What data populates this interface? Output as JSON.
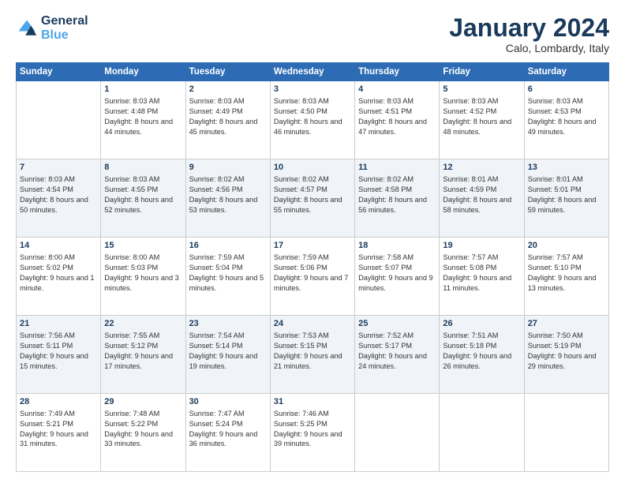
{
  "logo": {
    "line1": "General",
    "line2": "Blue"
  },
  "header": {
    "title": "January 2024",
    "location": "Calo, Lombardy, Italy"
  },
  "weekdays": [
    "Sunday",
    "Monday",
    "Tuesday",
    "Wednesday",
    "Thursday",
    "Friday",
    "Saturday"
  ],
  "weeks": [
    [
      {
        "day": "",
        "sunrise": "",
        "sunset": "",
        "daylight": ""
      },
      {
        "day": "1",
        "sunrise": "Sunrise: 8:03 AM",
        "sunset": "Sunset: 4:48 PM",
        "daylight": "Daylight: 8 hours and 44 minutes."
      },
      {
        "day": "2",
        "sunrise": "Sunrise: 8:03 AM",
        "sunset": "Sunset: 4:49 PM",
        "daylight": "Daylight: 8 hours and 45 minutes."
      },
      {
        "day": "3",
        "sunrise": "Sunrise: 8:03 AM",
        "sunset": "Sunset: 4:50 PM",
        "daylight": "Daylight: 8 hours and 46 minutes."
      },
      {
        "day": "4",
        "sunrise": "Sunrise: 8:03 AM",
        "sunset": "Sunset: 4:51 PM",
        "daylight": "Daylight: 8 hours and 47 minutes."
      },
      {
        "day": "5",
        "sunrise": "Sunrise: 8:03 AM",
        "sunset": "Sunset: 4:52 PM",
        "daylight": "Daylight: 8 hours and 48 minutes."
      },
      {
        "day": "6",
        "sunrise": "Sunrise: 8:03 AM",
        "sunset": "Sunset: 4:53 PM",
        "daylight": "Daylight: 8 hours and 49 minutes."
      }
    ],
    [
      {
        "day": "7",
        "sunrise": "Sunrise: 8:03 AM",
        "sunset": "Sunset: 4:54 PM",
        "daylight": "Daylight: 8 hours and 50 minutes."
      },
      {
        "day": "8",
        "sunrise": "Sunrise: 8:03 AM",
        "sunset": "Sunset: 4:55 PM",
        "daylight": "Daylight: 8 hours and 52 minutes."
      },
      {
        "day": "9",
        "sunrise": "Sunrise: 8:02 AM",
        "sunset": "Sunset: 4:56 PM",
        "daylight": "Daylight: 8 hours and 53 minutes."
      },
      {
        "day": "10",
        "sunrise": "Sunrise: 8:02 AM",
        "sunset": "Sunset: 4:57 PM",
        "daylight": "Daylight: 8 hours and 55 minutes."
      },
      {
        "day": "11",
        "sunrise": "Sunrise: 8:02 AM",
        "sunset": "Sunset: 4:58 PM",
        "daylight": "Daylight: 8 hours and 56 minutes."
      },
      {
        "day": "12",
        "sunrise": "Sunrise: 8:01 AM",
        "sunset": "Sunset: 4:59 PM",
        "daylight": "Daylight: 8 hours and 58 minutes."
      },
      {
        "day": "13",
        "sunrise": "Sunrise: 8:01 AM",
        "sunset": "Sunset: 5:01 PM",
        "daylight": "Daylight: 8 hours and 59 minutes."
      }
    ],
    [
      {
        "day": "14",
        "sunrise": "Sunrise: 8:00 AM",
        "sunset": "Sunset: 5:02 PM",
        "daylight": "Daylight: 9 hours and 1 minute."
      },
      {
        "day": "15",
        "sunrise": "Sunrise: 8:00 AM",
        "sunset": "Sunset: 5:03 PM",
        "daylight": "Daylight: 9 hours and 3 minutes."
      },
      {
        "day": "16",
        "sunrise": "Sunrise: 7:59 AM",
        "sunset": "Sunset: 5:04 PM",
        "daylight": "Daylight: 9 hours and 5 minutes."
      },
      {
        "day": "17",
        "sunrise": "Sunrise: 7:59 AM",
        "sunset": "Sunset: 5:06 PM",
        "daylight": "Daylight: 9 hours and 7 minutes."
      },
      {
        "day": "18",
        "sunrise": "Sunrise: 7:58 AM",
        "sunset": "Sunset: 5:07 PM",
        "daylight": "Daylight: 9 hours and 9 minutes."
      },
      {
        "day": "19",
        "sunrise": "Sunrise: 7:57 AM",
        "sunset": "Sunset: 5:08 PM",
        "daylight": "Daylight: 9 hours and 11 minutes."
      },
      {
        "day": "20",
        "sunrise": "Sunrise: 7:57 AM",
        "sunset": "Sunset: 5:10 PM",
        "daylight": "Daylight: 9 hours and 13 minutes."
      }
    ],
    [
      {
        "day": "21",
        "sunrise": "Sunrise: 7:56 AM",
        "sunset": "Sunset: 5:11 PM",
        "daylight": "Daylight: 9 hours and 15 minutes."
      },
      {
        "day": "22",
        "sunrise": "Sunrise: 7:55 AM",
        "sunset": "Sunset: 5:12 PM",
        "daylight": "Daylight: 9 hours and 17 minutes."
      },
      {
        "day": "23",
        "sunrise": "Sunrise: 7:54 AM",
        "sunset": "Sunset: 5:14 PM",
        "daylight": "Daylight: 9 hours and 19 minutes."
      },
      {
        "day": "24",
        "sunrise": "Sunrise: 7:53 AM",
        "sunset": "Sunset: 5:15 PM",
        "daylight": "Daylight: 9 hours and 21 minutes."
      },
      {
        "day": "25",
        "sunrise": "Sunrise: 7:52 AM",
        "sunset": "Sunset: 5:17 PM",
        "daylight": "Daylight: 9 hours and 24 minutes."
      },
      {
        "day": "26",
        "sunrise": "Sunrise: 7:51 AM",
        "sunset": "Sunset: 5:18 PM",
        "daylight": "Daylight: 9 hours and 26 minutes."
      },
      {
        "day": "27",
        "sunrise": "Sunrise: 7:50 AM",
        "sunset": "Sunset: 5:19 PM",
        "daylight": "Daylight: 9 hours and 29 minutes."
      }
    ],
    [
      {
        "day": "28",
        "sunrise": "Sunrise: 7:49 AM",
        "sunset": "Sunset: 5:21 PM",
        "daylight": "Daylight: 9 hours and 31 minutes."
      },
      {
        "day": "29",
        "sunrise": "Sunrise: 7:48 AM",
        "sunset": "Sunset: 5:22 PM",
        "daylight": "Daylight: 9 hours and 33 minutes."
      },
      {
        "day": "30",
        "sunrise": "Sunrise: 7:47 AM",
        "sunset": "Sunset: 5:24 PM",
        "daylight": "Daylight: 9 hours and 36 minutes."
      },
      {
        "day": "31",
        "sunrise": "Sunrise: 7:46 AM",
        "sunset": "Sunset: 5:25 PM",
        "daylight": "Daylight: 9 hours and 39 minutes."
      },
      {
        "day": "",
        "sunrise": "",
        "sunset": "",
        "daylight": ""
      },
      {
        "day": "",
        "sunrise": "",
        "sunset": "",
        "daylight": ""
      },
      {
        "day": "",
        "sunrise": "",
        "sunset": "",
        "daylight": ""
      }
    ]
  ]
}
